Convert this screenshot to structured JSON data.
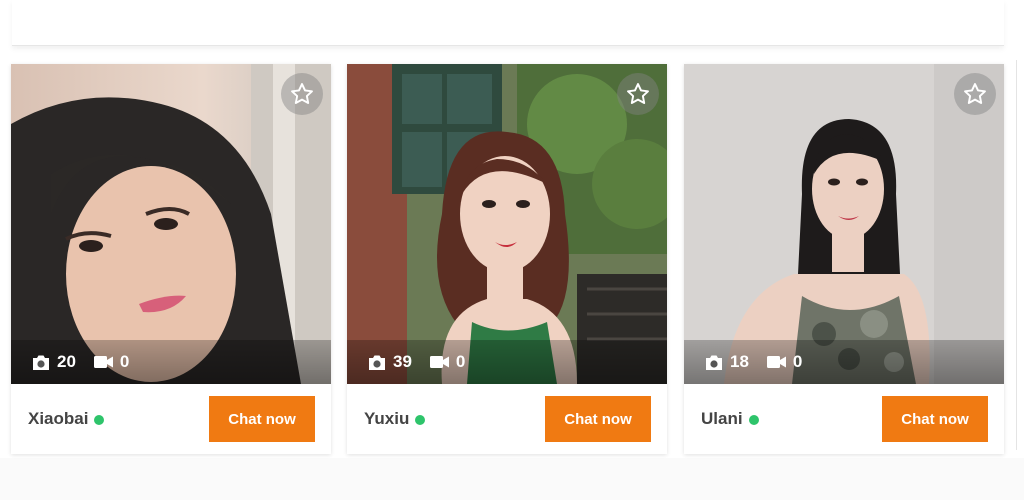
{
  "profiles": [
    {
      "name": "Xiaobai",
      "photo_count": "20",
      "video_count": "0",
      "online": true,
      "chat_label": "Chat now"
    },
    {
      "name": "Yuxiu",
      "photo_count": "39",
      "video_count": "0",
      "online": true,
      "chat_label": "Chat now"
    },
    {
      "name": "Ulani",
      "photo_count": "18",
      "video_count": "0",
      "online": true,
      "chat_label": "Chat now"
    }
  ],
  "icons": {
    "favorite": "star-outline-icon",
    "photos": "camera-icon",
    "videos": "video-camera-icon",
    "status": "online-dot"
  },
  "colors": {
    "accent": "#f07a12",
    "online": "#2ec46b",
    "name_text": "#444444"
  }
}
